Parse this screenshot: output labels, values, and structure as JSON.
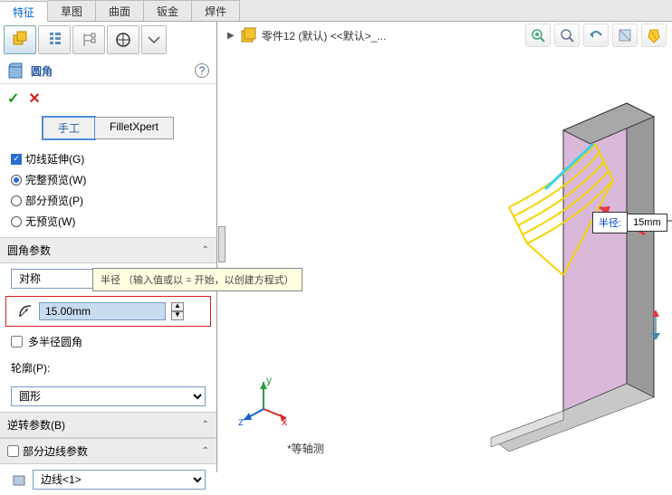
{
  "tabs": {
    "features": "特征",
    "sketch": "草图",
    "surface": "曲面",
    "sheetmetal": "钣金",
    "weldment": "焊件"
  },
  "feature": {
    "title": "圆角",
    "mode_manual": "手工",
    "mode_xpert": "FilletXpert"
  },
  "options": {
    "cut_extend": "切线延伸(G)",
    "full_preview": "完整预览(W)",
    "partial_preview": "部分预览(P)",
    "no_preview": "无预览(W)"
  },
  "sections": {
    "fillet_params": "圆角参数",
    "profile_label": "轮廓(P):",
    "reverse_params": "逆转参数(B)",
    "partial_edge": "部分边线参数"
  },
  "params": {
    "symmetric": "对称",
    "radius_value": "15.00mm",
    "multi_radius": "多半径圆角",
    "profile_circular": "圆形",
    "edge_placeholder": "边线<1>"
  },
  "tooltip": "半径 （输入值或以 = 开始，以创建方程式）",
  "breadcrumb": {
    "part": "零件12 (默认) <<默认>_..."
  },
  "callout": {
    "label": "半径:",
    "value": "15mm"
  },
  "triad": {
    "x": "x",
    "y": "y",
    "z": "z",
    "view": "*等轴测"
  }
}
